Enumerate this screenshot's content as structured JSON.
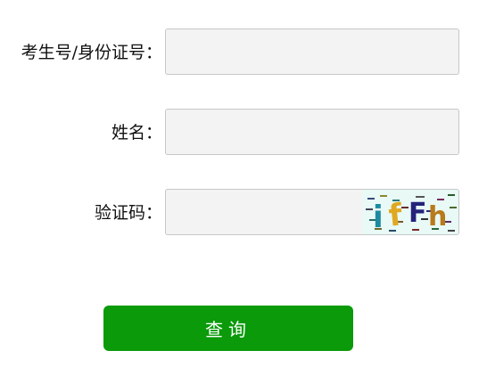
{
  "form": {
    "id_label": "考生号/身份证号：",
    "name_label": "姓名：",
    "captcha_label": "验证码：",
    "id_value": "",
    "name_value": "",
    "captcha_value": "",
    "captcha_image_text": "ifFh",
    "submit_label": "查询"
  },
  "colors": {
    "submit_bg": "#0a9a0a",
    "input_bg": "#f3f3f3",
    "input_border": "#c7c7c7",
    "captcha_bg": "#e8f9f6"
  }
}
